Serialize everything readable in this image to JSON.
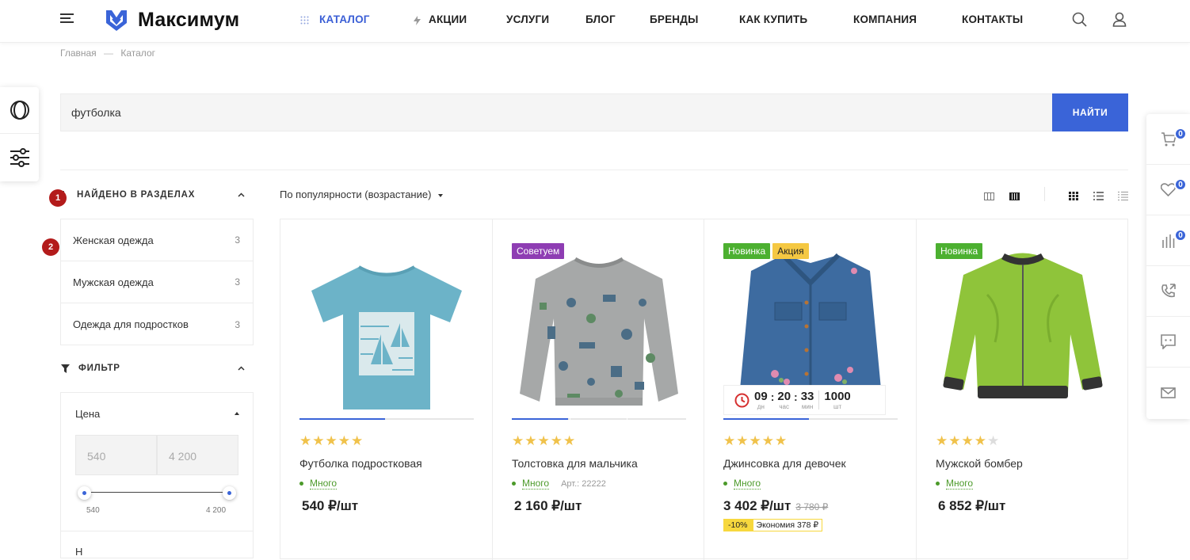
{
  "header": {
    "logo_text": "Максимум",
    "nav": [
      "КАТАЛОГ",
      "АКЦИИ",
      "УСЛУГИ",
      "БЛОГ",
      "БРЕНДЫ",
      "КАК КУПИТЬ",
      "КОМПАНИЯ",
      "КОНТАКТЫ"
    ],
    "accent_color": "#3a64d8"
  },
  "breadcrumbs": {
    "home": "Главная",
    "separator": "—",
    "current": "Каталог"
  },
  "search": {
    "value": "футболка",
    "button": "НАЙТИ"
  },
  "sidebar": {
    "found_title": "НАЙДЕНО В РАЗДЕЛАХ",
    "marker_1": "1",
    "marker_2": "2",
    "sections": [
      {
        "label": "Женская одежда",
        "count": "3"
      },
      {
        "label": "Мужская одежда",
        "count": "3"
      },
      {
        "label": "Одежда для подростков",
        "count": "3"
      }
    ],
    "filter_title": "ФИЛЬТР",
    "price_label": "Цена",
    "price_min": "540",
    "price_max": "4 200",
    "slider_min": "540",
    "slider_max": "4 200",
    "next_label": "Н"
  },
  "sort": {
    "label": "По популярности (возрастание)"
  },
  "products": [
    {
      "name": "Футболка подростковая",
      "rating": 5,
      "availability": "Много",
      "price": "540 ₽/шт",
      "tags": []
    },
    {
      "name": "Толстовка для мальчика",
      "rating": 5,
      "availability": "Много",
      "article": "Арт.: 22222",
      "price": "2 160 ₽/шт",
      "tags": [
        {
          "text": "Советуем",
          "color": "#8e3db3"
        }
      ]
    },
    {
      "name": "Джинсовка для девочек",
      "rating": 5,
      "availability": "Много",
      "price": "3 402 ₽/шт",
      "old_price": "3 780 ₽",
      "discount": "-10%",
      "economy": "Экономия 378 ₽",
      "tags": [
        {
          "text": "Новинка",
          "color": "#4cb030"
        },
        {
          "text": "Акция",
          "color": "#f5c842"
        }
      ],
      "timer": {
        "days": "09",
        "days_label": "дн",
        "hours": "20",
        "hours_label": "час",
        "mins": "33",
        "mins_label": "мин",
        "qty": "1000",
        "qty_label": "шт"
      }
    },
    {
      "name": "Мужской бомбер",
      "rating": 4,
      "availability": "Много",
      "price": "6 852 ₽/шт",
      "tags": [
        {
          "text": "Новинка",
          "color": "#4cb030"
        }
      ]
    }
  ],
  "right_panel": {
    "cart_count": "0",
    "favorites_count": "0",
    "compare_count": "0"
  },
  "icons": [
    "menu-icon",
    "search-icon",
    "user-icon",
    "cart-icon",
    "heart-icon",
    "compare-icon",
    "callback-icon",
    "chat-icon",
    "mail-icon",
    "filter-icon",
    "clock-icon"
  ]
}
